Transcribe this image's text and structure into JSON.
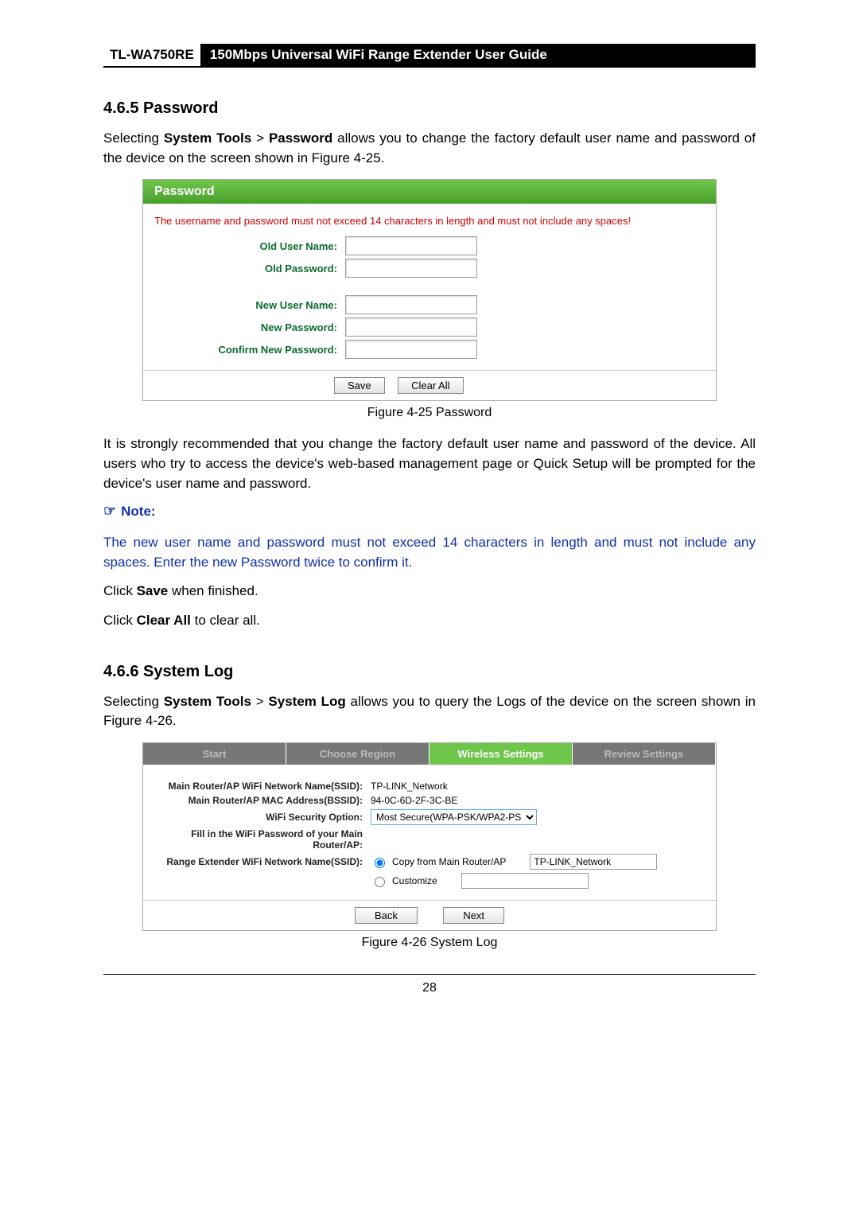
{
  "header": {
    "model": "TL-WA750RE",
    "title": "150Mbps Universal WiFi Range Extender User Guide"
  },
  "section1": {
    "heading": "4.6.5  Password",
    "intro_pre": "Selecting ",
    "bc1": "System Tools",
    "gt": " > ",
    "bc2": "Password",
    "intro_post": " allows you to change the factory default user name and password of the device on the screen shown in Figure 4-25."
  },
  "fig25": {
    "panel_title": "Password",
    "warning": "The username and password must not exceed 14 characters in length and must not include any spaces!",
    "labels": {
      "old_user": "Old User Name:",
      "old_pass": "Old Password:",
      "new_user": "New User Name:",
      "new_pass": "New Password:",
      "confirm": "Confirm New Password:"
    },
    "buttons": {
      "save": "Save",
      "clear": "Clear All"
    },
    "caption": "Figure 4-25 Password"
  },
  "para2": "It is strongly recommended that you change the factory default user name and password of the device. All users who try to access the device's web-based management page or Quick Setup will be prompted for the device's user name and password.",
  "note": {
    "head": "Note:",
    "text": "The new user name and password must not exceed 14 characters in length and must not include any spaces. Enter the new Password twice to confirm it."
  },
  "para3_pre": "Click ",
  "para3_b": "Save",
  "para3_post": " when finished.",
  "para4_pre": "Click ",
  "para4_b": "Clear All",
  "para4_post": " to clear all.",
  "section2": {
    "heading": "4.6.6  System Log",
    "intro_pre": "Selecting ",
    "bc1": "System Tools",
    "gt": " > ",
    "bc2": "System Log",
    "intro_post": " allows you to query the Logs of the device on the screen shown in Figure 4-26."
  },
  "fig26": {
    "tabs": {
      "start": "Start",
      "region": "Choose Region",
      "wireless": "Wireless Settings",
      "review": "Review Settings"
    },
    "rows": {
      "ssid_lbl": "Main Router/AP WiFi Network Name(SSID):",
      "ssid_val": "TP-LINK_Network",
      "bssid_lbl": "Main Router/AP MAC Address(BSSID):",
      "bssid_val": "94-0C-6D-2F-3C-BE",
      "sec_lbl": "WiFi Security Option:",
      "sec_val": "Most Secure(WPA-PSK/WPA2-PS",
      "pw_lbl": "Fill in the WiFi Password of your Main Router/AP:",
      "re_lbl": "Range Extender WiFi Network Name(SSID):",
      "radio_copy": "Copy from Main Router/AP",
      "radio_custom": "Customize",
      "re_val": "TP-LINK_Network"
    },
    "buttons": {
      "back": "Back",
      "next": "Next"
    },
    "caption": "Figure 4-26 System Log"
  },
  "page_number": "28"
}
